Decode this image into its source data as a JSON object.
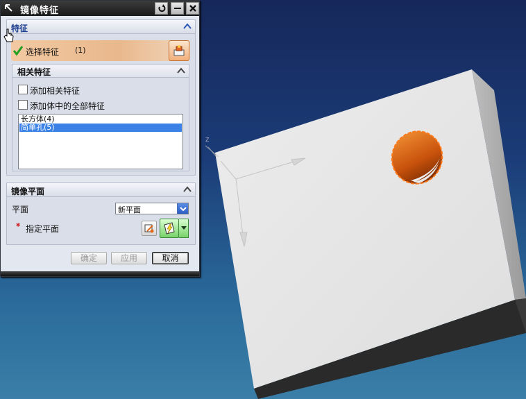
{
  "dialog": {
    "title": "镜像特征",
    "features_section": {
      "title": "特征",
      "select_label": "选择特征",
      "select_count": "(1)"
    },
    "related_section": {
      "title": "相关特征",
      "checkbox_add_related": "添加相关特征",
      "checkbox_add_all_in_body": "添加体中的全部特征",
      "list_items": [
        "长方体(4)",
        "简单孔(5)"
      ],
      "selected_index": 1
    },
    "mirror_plane_section": {
      "title": "镜像平面",
      "plane_label": "平面",
      "plane_value": "新平面",
      "specify_label": "指定平面",
      "required_mark": "*"
    },
    "buttons": {
      "ok": "确定",
      "apply": "应用",
      "cancel": "取消"
    }
  },
  "colors": {
    "select_row_accent": "#ebb88a",
    "selected_list_bg": "#3c82e6",
    "viewport_bg_top": "#16285a",
    "viewport_bg_bottom": "#3a7fa8",
    "hole_orange": "#e8721e"
  }
}
